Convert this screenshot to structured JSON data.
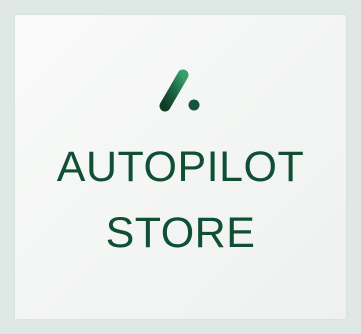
{
  "colors": {
    "background": "#dfe8e4",
    "card": "#f5f6f5",
    "brand_green": "#114f35",
    "logo_gradient_start": "#0f3b27",
    "logo_gradient_end": "#35a06a"
  },
  "logo": {
    "icon": "autopilot-logo-icon"
  },
  "brand": {
    "line1": "AUTOPILOT",
    "line2": "STORE"
  }
}
